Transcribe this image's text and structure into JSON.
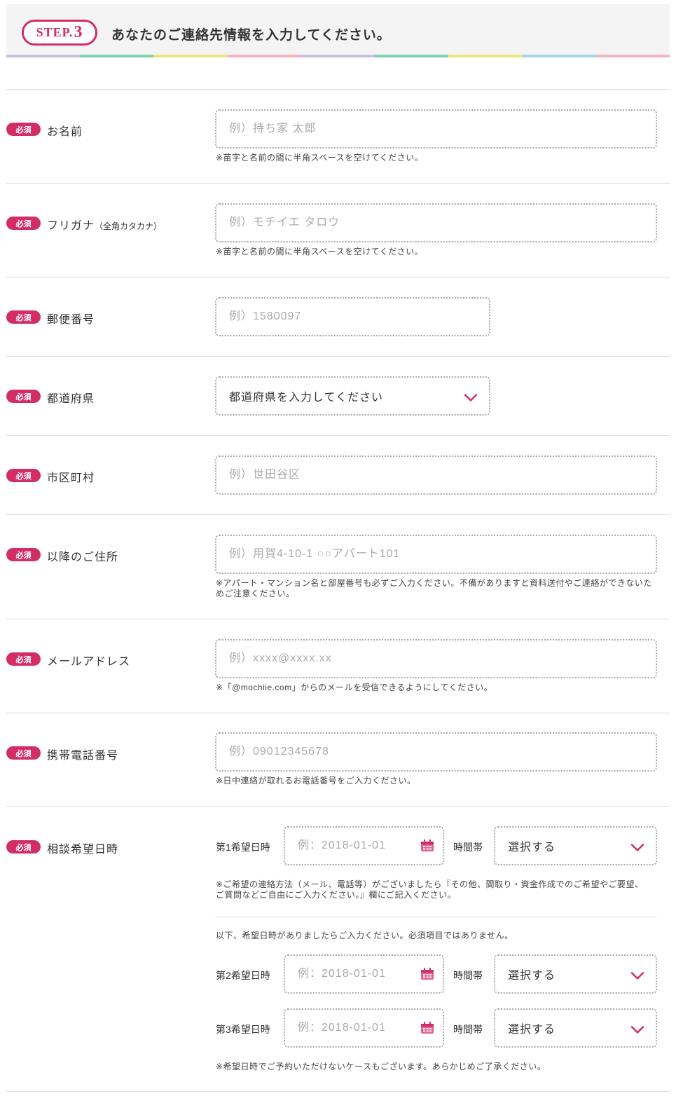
{
  "header": {
    "step_word": "STEP.",
    "step_num": "3",
    "title": "あなたのご連絡先情報を入力してください。"
  },
  "colors": {
    "accent": "#d22e64",
    "rainbow": [
      "#c9bfe3",
      "#7ad3ae",
      "#f2e27a",
      "#f3b4c6",
      "#c9bfe3",
      "#7ad3ae",
      "#f2e27a",
      "#a7d6ea",
      "#f3b4c6"
    ]
  },
  "required_label": "必須",
  "form": {
    "name": {
      "label": "お名前",
      "placeholder": "例）持ち家 太郎",
      "note": "※苗字と名前の間に半角スペースを空けてください。"
    },
    "kana": {
      "label": "フリガナ",
      "label_suffix": "（全角カタカナ）",
      "placeholder": "例）モチイエ タロウ",
      "note": "※苗字と名前の間に半角スペースを空けてください。"
    },
    "postal": {
      "label": "郵便番号",
      "placeholder": "例）1580097"
    },
    "prefecture": {
      "label": "都道府県",
      "selected": "都道府県を入力してください"
    },
    "city": {
      "label": "市区町村",
      "placeholder": "例）世田谷区"
    },
    "address": {
      "label": "以降のご住所",
      "placeholder": "例）用賀4-10-1 ○○アパート101",
      "note": "※アパート・マンション名と部屋番号も必ずご入力ください。不備がありますと資料送付やご連絡ができないためご注意ください。"
    },
    "email": {
      "label": "メールアドレス",
      "placeholder": "例）xxxx@xxxx.xx",
      "note": "※「@mochiie.com」からのメールを受信できるようにしてください。"
    },
    "phone": {
      "label": "携帯電話番号",
      "placeholder": "例）09012345678",
      "note": "※日中連絡が取れるお電話番号をご入力ください。"
    },
    "consult": {
      "label": "相談希望日時",
      "date1_label": "第1希望日時",
      "date2_label": "第2希望日時",
      "date3_label": "第3希望日時",
      "date_placeholder": "例：2018-01-01",
      "time_label": "時間帯",
      "time_selected": "選択する",
      "note1": "※ご希望の連絡方法（メール、電話等）がございましたら『その他、間取り・資金作成でのご希望やご要望、ご質問などご自由にご入力ください。』欄にご記入ください。",
      "optional_note": "以下、希望日時がありましたらご入力ください。必須項目ではありません。",
      "note2": "※希望日時でご予約いただけないケースもございます。あらかじめご了承ください。"
    }
  }
}
